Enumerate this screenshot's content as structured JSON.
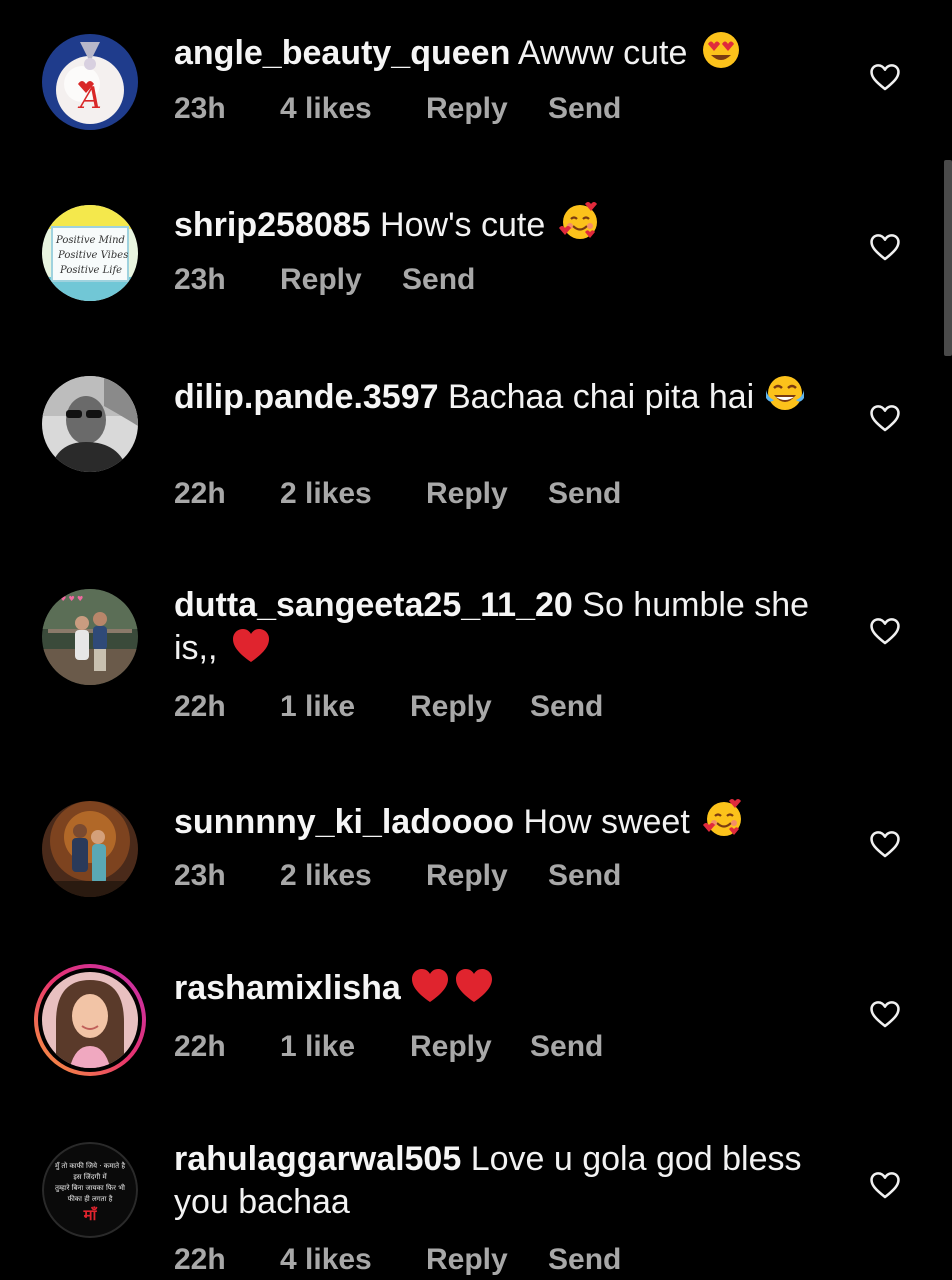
{
  "comments": [
    {
      "username": "angle_beauty_queen",
      "text": "Awww cute",
      "emoji": "heart-eyes",
      "time": "23h",
      "likes": "4 likes",
      "reply": "Reply",
      "send": "Send"
    },
    {
      "username": "shrip258085",
      "text": "How's cute",
      "emoji": "smiling-hearts",
      "time": "23h",
      "likes": "",
      "reply": "Reply",
      "send": "Send"
    },
    {
      "username": "dilip.pande.3597",
      "text": "Bachaa chai pita hai",
      "emoji": "tears-of-joy",
      "time": "22h",
      "likes": "2 likes",
      "reply": "Reply",
      "send": "Send"
    },
    {
      "username": "dutta_sangeeta25_11_20",
      "text": "So humble she is,,",
      "emoji": "red-heart",
      "time": "22h",
      "likes": "1 like",
      "reply": "Reply",
      "send": "Send"
    },
    {
      "username": "sunnnny_ki_ladoooo",
      "text": "How sweet",
      "emoji": "smiling-hearts",
      "time": "23h",
      "likes": "2 likes",
      "reply": "Reply",
      "send": "Send"
    },
    {
      "username": "rashamixlisha",
      "text": "",
      "emoji": "two-red-hearts",
      "time": "22h",
      "likes": "1 like",
      "reply": "Reply",
      "send": "Send"
    },
    {
      "username": "rahulaggarwal505",
      "text": "Love u gola god bless you bachaa",
      "emoji": "",
      "time": "22h",
      "likes": "4 likes",
      "reply": "Reply",
      "send": "Send"
    }
  ],
  "avatars": {
    "shrip_lines": [
      "Positive Mind",
      "Positive Vibes",
      "Positive Life"
    ],
    "rahul_lines": [
      "मुँ तो काफी जिये · कमाते है",
      "इस जिंदगी में",
      "तुम्हारे बिना जायका फिर भी",
      "फीका ही लगता है",
      "माँ"
    ]
  },
  "colors": {
    "background": "#000000",
    "meta": "#a8a8a8",
    "text": "#f2f2f2"
  }
}
